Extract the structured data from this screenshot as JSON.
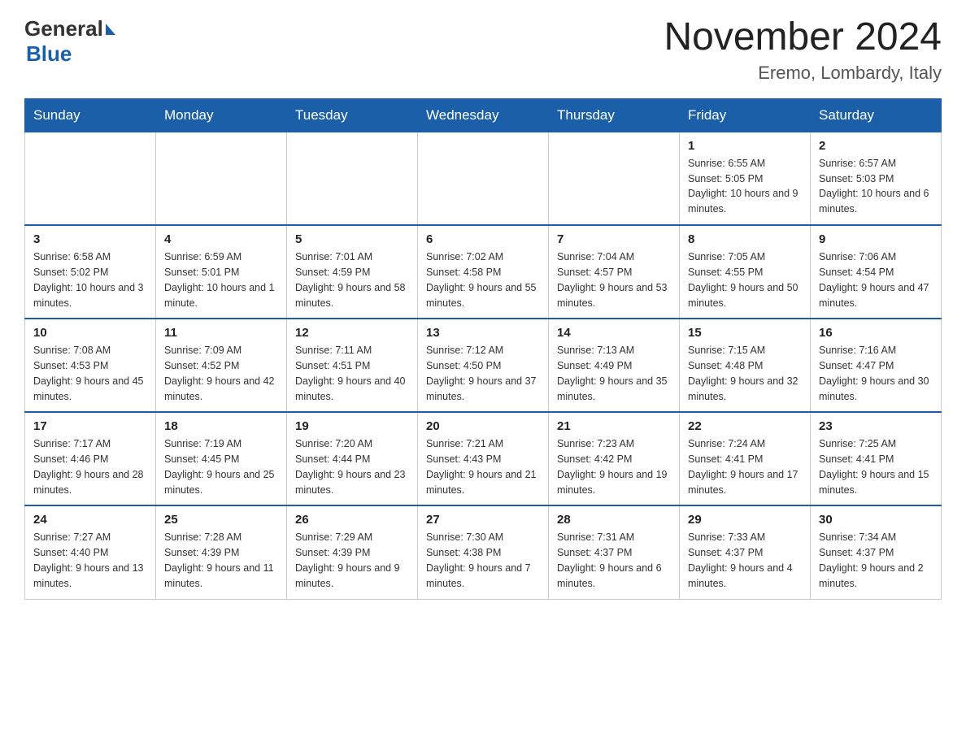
{
  "header": {
    "logo_general": "General",
    "logo_blue": "Blue",
    "month_title": "November 2024",
    "location": "Eremo, Lombardy, Italy"
  },
  "weekdays": [
    "Sunday",
    "Monday",
    "Tuesday",
    "Wednesday",
    "Thursday",
    "Friday",
    "Saturday"
  ],
  "weeks": [
    [
      {
        "day": "",
        "info": ""
      },
      {
        "day": "",
        "info": ""
      },
      {
        "day": "",
        "info": ""
      },
      {
        "day": "",
        "info": ""
      },
      {
        "day": "",
        "info": ""
      },
      {
        "day": "1",
        "info": "Sunrise: 6:55 AM\nSunset: 5:05 PM\nDaylight: 10 hours and 9 minutes."
      },
      {
        "day": "2",
        "info": "Sunrise: 6:57 AM\nSunset: 5:03 PM\nDaylight: 10 hours and 6 minutes."
      }
    ],
    [
      {
        "day": "3",
        "info": "Sunrise: 6:58 AM\nSunset: 5:02 PM\nDaylight: 10 hours and 3 minutes."
      },
      {
        "day": "4",
        "info": "Sunrise: 6:59 AM\nSunset: 5:01 PM\nDaylight: 10 hours and 1 minute."
      },
      {
        "day": "5",
        "info": "Sunrise: 7:01 AM\nSunset: 4:59 PM\nDaylight: 9 hours and 58 minutes."
      },
      {
        "day": "6",
        "info": "Sunrise: 7:02 AM\nSunset: 4:58 PM\nDaylight: 9 hours and 55 minutes."
      },
      {
        "day": "7",
        "info": "Sunrise: 7:04 AM\nSunset: 4:57 PM\nDaylight: 9 hours and 53 minutes."
      },
      {
        "day": "8",
        "info": "Sunrise: 7:05 AM\nSunset: 4:55 PM\nDaylight: 9 hours and 50 minutes."
      },
      {
        "day": "9",
        "info": "Sunrise: 7:06 AM\nSunset: 4:54 PM\nDaylight: 9 hours and 47 minutes."
      }
    ],
    [
      {
        "day": "10",
        "info": "Sunrise: 7:08 AM\nSunset: 4:53 PM\nDaylight: 9 hours and 45 minutes."
      },
      {
        "day": "11",
        "info": "Sunrise: 7:09 AM\nSunset: 4:52 PM\nDaylight: 9 hours and 42 minutes."
      },
      {
        "day": "12",
        "info": "Sunrise: 7:11 AM\nSunset: 4:51 PM\nDaylight: 9 hours and 40 minutes."
      },
      {
        "day": "13",
        "info": "Sunrise: 7:12 AM\nSunset: 4:50 PM\nDaylight: 9 hours and 37 minutes."
      },
      {
        "day": "14",
        "info": "Sunrise: 7:13 AM\nSunset: 4:49 PM\nDaylight: 9 hours and 35 minutes."
      },
      {
        "day": "15",
        "info": "Sunrise: 7:15 AM\nSunset: 4:48 PM\nDaylight: 9 hours and 32 minutes."
      },
      {
        "day": "16",
        "info": "Sunrise: 7:16 AM\nSunset: 4:47 PM\nDaylight: 9 hours and 30 minutes."
      }
    ],
    [
      {
        "day": "17",
        "info": "Sunrise: 7:17 AM\nSunset: 4:46 PM\nDaylight: 9 hours and 28 minutes."
      },
      {
        "day": "18",
        "info": "Sunrise: 7:19 AM\nSunset: 4:45 PM\nDaylight: 9 hours and 25 minutes."
      },
      {
        "day": "19",
        "info": "Sunrise: 7:20 AM\nSunset: 4:44 PM\nDaylight: 9 hours and 23 minutes."
      },
      {
        "day": "20",
        "info": "Sunrise: 7:21 AM\nSunset: 4:43 PM\nDaylight: 9 hours and 21 minutes."
      },
      {
        "day": "21",
        "info": "Sunrise: 7:23 AM\nSunset: 4:42 PM\nDaylight: 9 hours and 19 minutes."
      },
      {
        "day": "22",
        "info": "Sunrise: 7:24 AM\nSunset: 4:41 PM\nDaylight: 9 hours and 17 minutes."
      },
      {
        "day": "23",
        "info": "Sunrise: 7:25 AM\nSunset: 4:41 PM\nDaylight: 9 hours and 15 minutes."
      }
    ],
    [
      {
        "day": "24",
        "info": "Sunrise: 7:27 AM\nSunset: 4:40 PM\nDaylight: 9 hours and 13 minutes."
      },
      {
        "day": "25",
        "info": "Sunrise: 7:28 AM\nSunset: 4:39 PM\nDaylight: 9 hours and 11 minutes."
      },
      {
        "day": "26",
        "info": "Sunrise: 7:29 AM\nSunset: 4:39 PM\nDaylight: 9 hours and 9 minutes."
      },
      {
        "day": "27",
        "info": "Sunrise: 7:30 AM\nSunset: 4:38 PM\nDaylight: 9 hours and 7 minutes."
      },
      {
        "day": "28",
        "info": "Sunrise: 7:31 AM\nSunset: 4:37 PM\nDaylight: 9 hours and 6 minutes."
      },
      {
        "day": "29",
        "info": "Sunrise: 7:33 AM\nSunset: 4:37 PM\nDaylight: 9 hours and 4 minutes."
      },
      {
        "day": "30",
        "info": "Sunrise: 7:34 AM\nSunset: 4:37 PM\nDaylight: 9 hours and 2 minutes."
      }
    ]
  ]
}
